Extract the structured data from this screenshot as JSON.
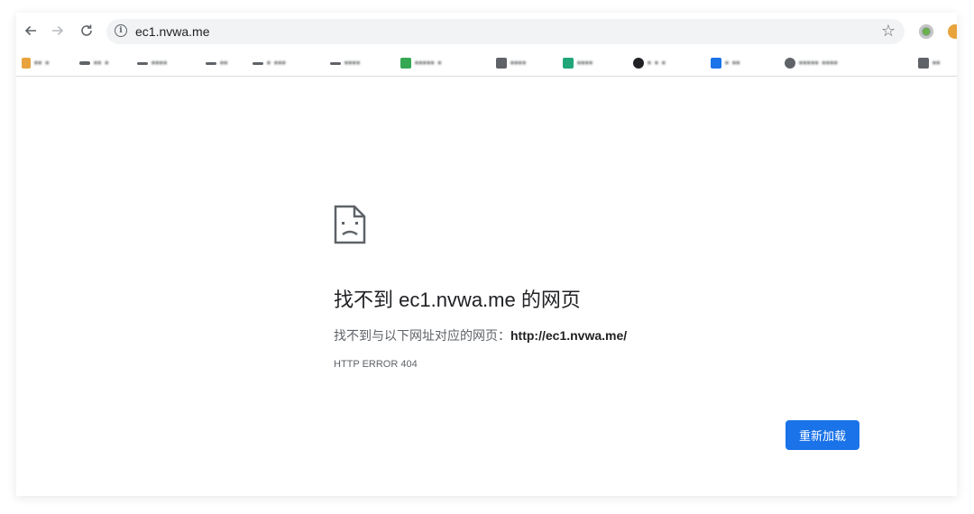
{
  "toolbar": {
    "back_icon": "back-arrow-icon",
    "forward_icon": "forward-arrow-icon",
    "reload_icon": "reload-icon",
    "url": "ec1.nvwa.me",
    "info_icon": "info-icon",
    "bookmark_star_icon": "star-icon"
  },
  "bookmarks_bar": {
    "note": "labels are pixelated/unreadable in the screenshot",
    "items": [
      {
        "icon_color": "#e8a33d"
      },
      {
        "icon_color": "#5f6368"
      },
      {
        "icon_color": "#5f6368"
      },
      {
        "icon_color": "#5f6368"
      },
      {
        "icon_color": "#5f6368"
      },
      {
        "icon_color": "#5f6368"
      },
      {
        "icon_color": "#34a853"
      },
      {
        "icon_color": "#5f6368"
      },
      {
        "icon_color": "#21a67a"
      },
      {
        "icon_color": "#202124"
      },
      {
        "icon_color": "#1a73e8"
      },
      {
        "icon_color": "#5f6368"
      },
      {
        "icon_color": "#5f6368"
      }
    ]
  },
  "error": {
    "icon": "sad-page-icon",
    "title": "找不到 ec1.nvwa.me 的网页",
    "desc_prefix": "找不到与以下网址对应的网页：",
    "desc_url": "http://ec1.nvwa.me/",
    "code": "HTTP ERROR 404"
  },
  "actions": {
    "reload_label": "重新加载"
  },
  "colors": {
    "primary": "#1a73e8",
    "text": "#202124",
    "secondary_text": "#5f6368"
  }
}
